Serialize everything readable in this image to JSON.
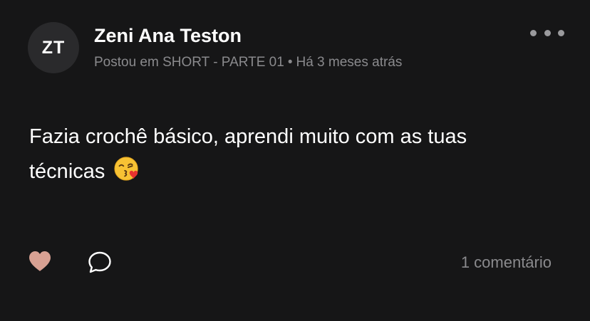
{
  "post": {
    "author_initials": "ZT",
    "author_name": "Zeni Ana Teston",
    "posted_in": "Postou em SHORT - PARTE 01",
    "separator": "•",
    "time_ago": "Há 3 meses atrás",
    "body_text": "Fazia crochê básico, aprendi muito com as tuas técnicas",
    "emoji": "face-blowing-a-kiss"
  },
  "actions": {
    "like_icon": "heart-icon",
    "comment_icon": "comment-bubble-icon",
    "more_icon": "more-horizontal-icon",
    "comment_count_label": "1 comentário"
  },
  "colors": {
    "background": "#161617",
    "avatar_bg": "#2a2a2c",
    "meta_text": "#8a8a8d",
    "heart": "#d8a193"
  }
}
